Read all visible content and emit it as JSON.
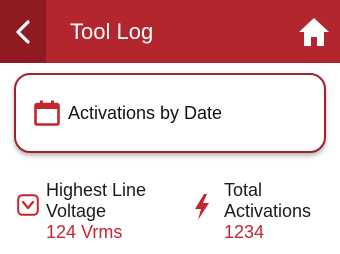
{
  "header": {
    "title": "Tool Log",
    "back_icon": "chevron-left-icon",
    "home_icon": "home-icon",
    "color": "#b3262e"
  },
  "card": {
    "label": "Activations by Date",
    "icon": "calendar-icon"
  },
  "stats": [
    {
      "icon": "voltage-chevron-icon",
      "label_line1": "Highest Line",
      "label_line2": "Voltage",
      "value": "124 Vrms"
    },
    {
      "icon": "lightning-bolt-icon",
      "label_line1": "Total",
      "label_line2": "Activations",
      "value": "1234"
    }
  ],
  "colors": {
    "accent": "#c4262f",
    "dark_accent": "#8f1a22"
  }
}
